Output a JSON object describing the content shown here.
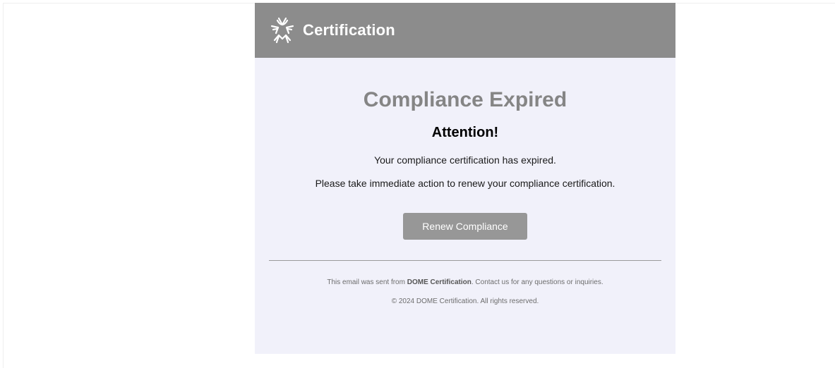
{
  "header": {
    "logo_icon": "dome-star-logo-icon",
    "title": "Certification",
    "background": "#8c8c8c"
  },
  "main": {
    "headline": "Compliance Expired",
    "attention": "Attention!",
    "message_1": "Your compliance certification has expired.",
    "message_2": "Please take immediate action to renew your compliance certification.",
    "button_label": "Renew Compliance"
  },
  "footer": {
    "line1_prefix": "This email was sent from ",
    "line1_brand": "DOME Certification",
    "line1_suffix": ". Contact us for any questions or inquiries.",
    "line2": "© 2024 DOME Certification. All rights reserved."
  },
  "colors": {
    "email_background": "#f1f1fa",
    "headline": "#858585",
    "button": "#979797"
  }
}
